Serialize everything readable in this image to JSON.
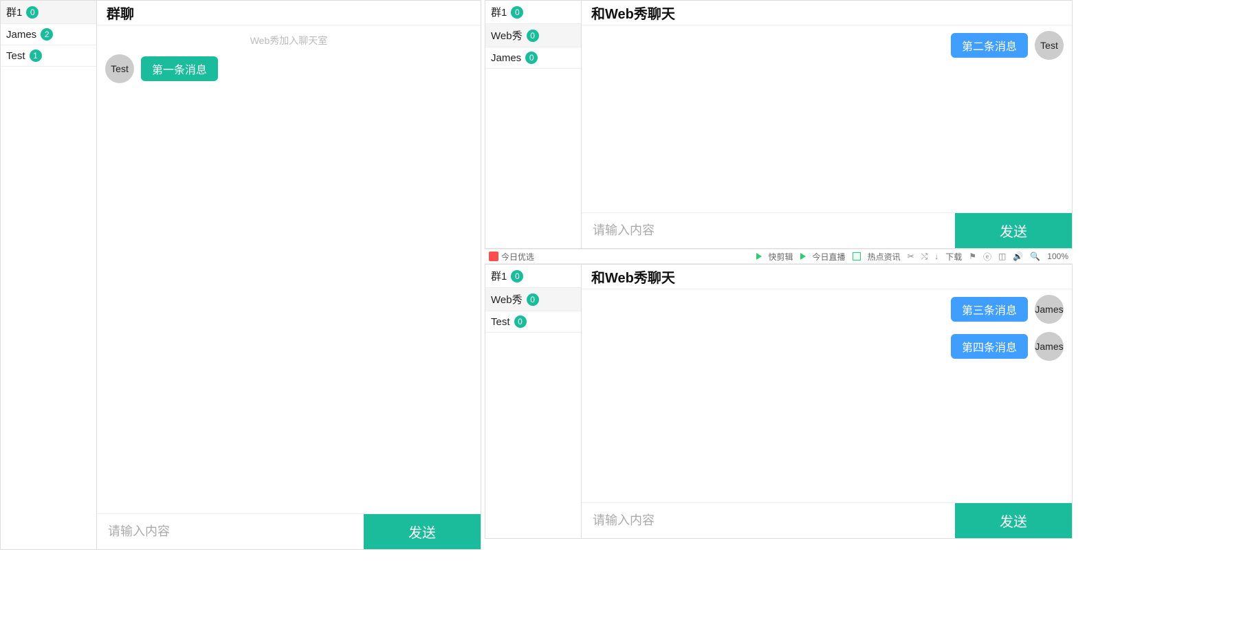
{
  "paneA": {
    "sidebar": [
      {
        "label": "群1",
        "badge": "0",
        "selected": true
      },
      {
        "label": "James",
        "badge": "2",
        "selected": false
      },
      {
        "label": "Test",
        "badge": "1",
        "selected": false
      }
    ],
    "title": "群聊",
    "system_msg": "Web秀加入聊天室",
    "messages": [
      {
        "side": "left",
        "avatar": "Test",
        "text": "第一条消息",
        "color": "teal"
      }
    ],
    "input_placeholder": "请输入内容",
    "send_label": "发送"
  },
  "paneB": {
    "sidebar": [
      {
        "label": "群1",
        "badge": "0",
        "selected": false
      },
      {
        "label": "Web秀",
        "badge": "0",
        "selected": true
      },
      {
        "label": "James",
        "badge": "0",
        "selected": false
      }
    ],
    "title": "和Web秀聊天",
    "messages": [
      {
        "side": "right",
        "avatar": "Test",
        "text": "第二条消息",
        "color": "blue"
      }
    ],
    "input_placeholder": "请输入内容",
    "send_label": "发送"
  },
  "paneC": {
    "sidebar": [
      {
        "label": "群1",
        "badge": "0",
        "selected": false
      },
      {
        "label": "Web秀",
        "badge": "0",
        "selected": true
      },
      {
        "label": "Test",
        "badge": "0",
        "selected": false
      }
    ],
    "title": "和Web秀聊天",
    "messages": [
      {
        "side": "right",
        "avatar": "James",
        "text": "第三条消息",
        "color": "blue"
      },
      {
        "side": "right",
        "avatar": "James",
        "text": "第四条消息",
        "color": "blue"
      }
    ],
    "input_placeholder": "请输入内容",
    "send_label": "发送"
  },
  "statusbar": {
    "left": "今日优选",
    "item1": "快剪辑",
    "item2": "今日直播",
    "item3": "热点资讯",
    "download": "下载",
    "zoom": "100%"
  },
  "colors": {
    "teal": "#1abc9c",
    "blue": "#409EFF"
  }
}
